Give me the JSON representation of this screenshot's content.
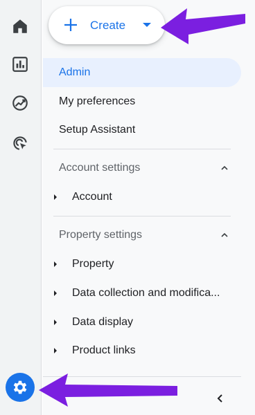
{
  "rail": {
    "items": [
      {
        "name": "home-icon"
      },
      {
        "name": "reports-icon"
      },
      {
        "name": "explore-icon"
      },
      {
        "name": "advertising-icon"
      }
    ],
    "settings": {
      "name": "gear-icon"
    }
  },
  "create": {
    "label": "Create"
  },
  "nav": {
    "admin": "Admin",
    "preferences": "My preferences",
    "setup": "Setup Assistant"
  },
  "account_settings": {
    "heading": "Account settings",
    "items": [
      "Account"
    ]
  },
  "property_settings": {
    "heading": "Property settings",
    "items": [
      "Property",
      "Data collection and modifica...",
      "Data display",
      "Product links"
    ]
  },
  "colors": {
    "accent": "#1a73e8",
    "selected_bg": "#e8f0fe",
    "annotation_arrow": "#7b1fe0"
  }
}
